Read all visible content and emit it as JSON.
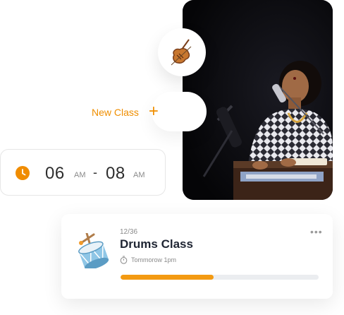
{
  "photo": {
    "subject": "performer-photo"
  },
  "new_class": {
    "label": "New Class",
    "plus": "+"
  },
  "time": {
    "start_hour": "06",
    "start_period": "AM",
    "separator": "-",
    "end_hour": "08",
    "end_period": "AM"
  },
  "class_card": {
    "count": "12/36",
    "title": "Drums Class",
    "schedule": "Tommorow 1pm",
    "more": "•••",
    "progress": 0.47
  },
  "colors": {
    "accent": "#ef8e00",
    "progress_fill": "#f39a12",
    "progress_track": "#ebedf0"
  },
  "icons": [
    "violin-icon",
    "clock-icon",
    "drum-icon",
    "timer-icon",
    "more-icon"
  ]
}
